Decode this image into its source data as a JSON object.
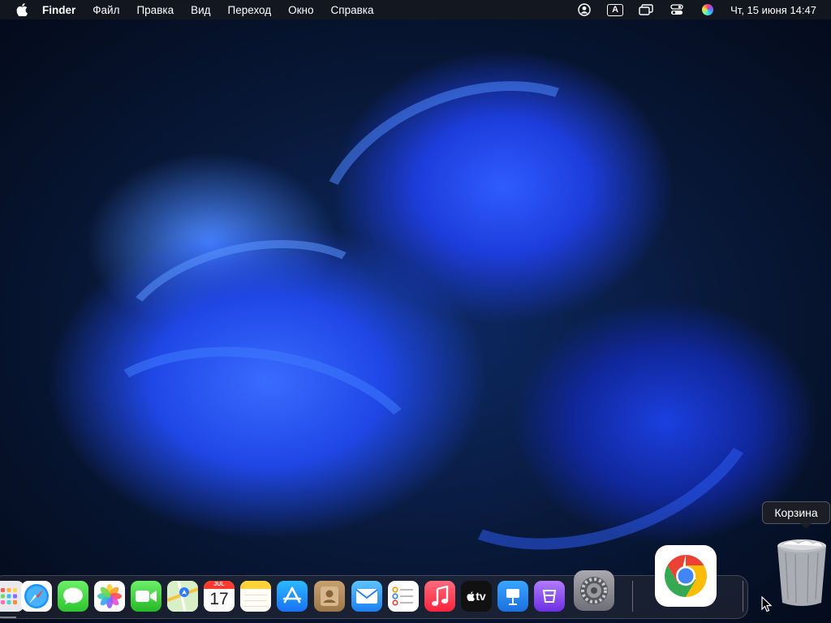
{
  "menubar": {
    "apple_icon": "apple-logo-icon",
    "app_name": "Finder",
    "menus": [
      "Файл",
      "Правка",
      "Вид",
      "Переход",
      "Окно",
      "Справка"
    ],
    "status_icons": [
      "user-account-icon",
      "input-source-icon",
      "screen-mirroring-icon",
      "control-center-icon",
      "siri-icon"
    ],
    "input_source_label": "A",
    "datetime": "Чт, 15 июня  14:47"
  },
  "dock": {
    "apps": [
      {
        "name": "Launchpad",
        "icon": "launchpad-icon"
      },
      {
        "name": "Safari",
        "icon": "safari-icon"
      },
      {
        "name": "Messages",
        "icon": "messages-icon"
      },
      {
        "name": "Photos",
        "icon": "photos-icon"
      },
      {
        "name": "FaceTime",
        "icon": "facetime-icon"
      },
      {
        "name": "Maps",
        "icon": "maps-icon"
      },
      {
        "name": "Calendar",
        "icon": "calendar-icon",
        "month": "JUL",
        "day": "17"
      },
      {
        "name": "Notes",
        "icon": "notes-icon"
      },
      {
        "name": "App Store",
        "icon": "app-store-icon"
      },
      {
        "name": "Contacts",
        "icon": "contacts-icon"
      },
      {
        "name": "Mail",
        "icon": "mail-icon"
      },
      {
        "name": "Reminders",
        "icon": "reminders-icon"
      },
      {
        "name": "Music",
        "icon": "music-icon"
      },
      {
        "name": "Apple TV",
        "icon": "tv-icon",
        "label": "tv"
      },
      {
        "name": "Keynote",
        "icon": "keynote-icon"
      },
      {
        "name": "Podcast Studio",
        "icon": "purple-app-icon"
      },
      {
        "name": "System Settings",
        "icon": "system-settings-icon"
      },
      {
        "name": "Google Chrome",
        "icon": "chrome-icon"
      },
      {
        "name": "Trash",
        "icon": "trash-icon"
      }
    ],
    "trash_tooltip": "Корзина"
  },
  "colors": {
    "menubar_bg": "#14181f",
    "wallpaper_accent": "#2f5cff"
  }
}
